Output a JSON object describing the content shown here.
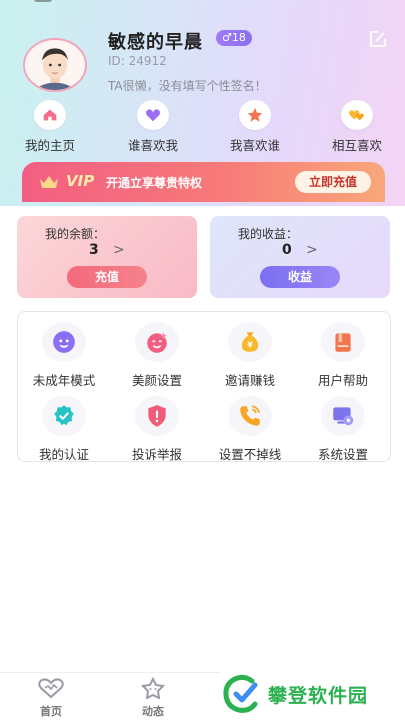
{
  "profile": {
    "nickname": "敏感的早晨",
    "gender_badge": "♂18",
    "user_id": "ID: 24912",
    "signature": "TA很懒，没有填写个性签名！",
    "edit_icon": "edit-icon",
    "avatar_icon": "avatar-cartoon"
  },
  "quick_nav": [
    {
      "label": "我的主页",
      "icon": "home-icon"
    },
    {
      "label": "谁喜欢我",
      "icon": "heart-icon"
    },
    {
      "label": "我喜欢谁",
      "icon": "star-icon"
    },
    {
      "label": "相互喜欢",
      "icon": "mutual-heart-icon"
    }
  ],
  "vip": {
    "badge": "VIP",
    "promo": "开通立享尊贵特权",
    "button": "立即充值"
  },
  "balance": {
    "title": "我的余额：",
    "value": "3",
    "arrow": ">",
    "button": "充值"
  },
  "income": {
    "title": "我的收益：",
    "value": "0",
    "arrow": ">",
    "button": "收益"
  },
  "grid": [
    {
      "label": "未成年模式",
      "icon": "face-icon"
    },
    {
      "label": "美颜设置",
      "icon": "beauty-icon"
    },
    {
      "label": "邀请赚钱",
      "icon": "money-bag-icon"
    },
    {
      "label": "用户帮助",
      "icon": "help-book-icon"
    },
    {
      "label": "我的认证",
      "icon": "verified-icon"
    },
    {
      "label": "投诉举报",
      "icon": "report-shield-icon"
    },
    {
      "label": "设置不掉线",
      "icon": "phone-icon"
    },
    {
      "label": "系统设置",
      "icon": "settings-icon"
    }
  ],
  "tabs": [
    {
      "label": "首页",
      "icon": "home-tab-icon"
    },
    {
      "label": "动态",
      "icon": "moments-tab-icon"
    }
  ],
  "watermark": {
    "text": "攀登软件园"
  },
  "colors": {
    "accent_purple": "#8a6ef2",
    "vip_pink": "#f35e83",
    "recharge_red": "#f46a7b",
    "watermark_green": "#2bb14f"
  }
}
